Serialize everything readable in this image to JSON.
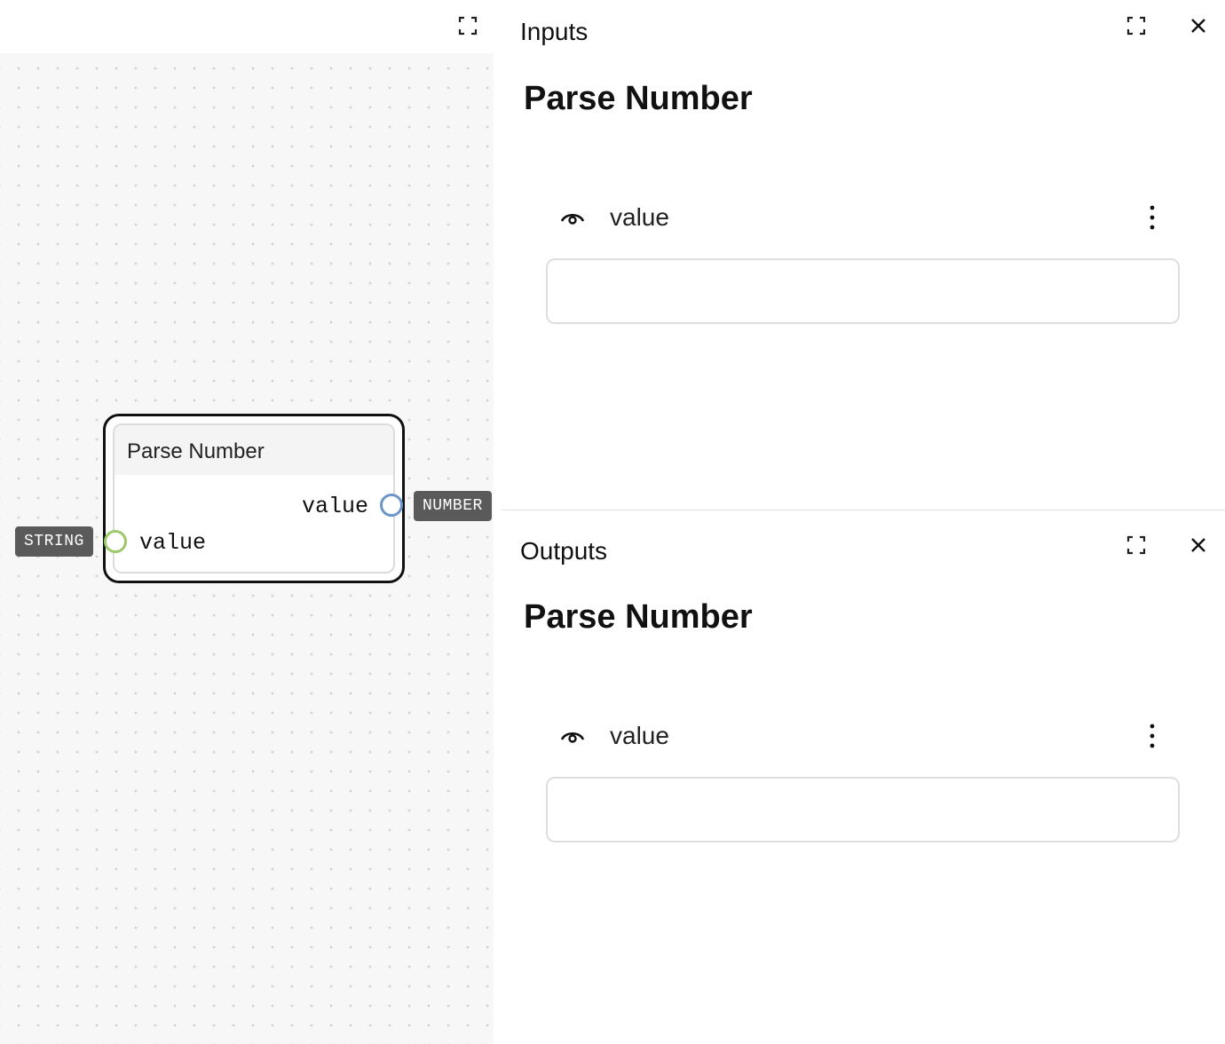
{
  "canvas": {
    "node": {
      "title": "Parse Number",
      "input_port": {
        "label": "value",
        "type": "STRING",
        "color": "#9cc96b"
      },
      "output_port": {
        "label": "value",
        "type": "NUMBER",
        "color": "#6b95c9"
      }
    },
    "icons": {
      "expand": "expand-icon"
    }
  },
  "inputs_panel": {
    "title": "Inputs",
    "node_title": "Parse Number",
    "fields": [
      {
        "label": "value",
        "value": "",
        "placeholder": ""
      }
    ],
    "icons": {
      "expand": "expand-icon",
      "close": "close-icon",
      "visibility": "eye-icon",
      "menu": "more-vertical-icon"
    }
  },
  "outputs_panel": {
    "title": "Outputs",
    "node_title": "Parse Number",
    "fields": [
      {
        "label": "value",
        "value": "",
        "placeholder": ""
      }
    ],
    "icons": {
      "expand": "expand-icon",
      "close": "close-icon",
      "visibility": "eye-icon",
      "menu": "more-vertical-icon"
    }
  },
  "colors": {
    "canvas_bg": "#f7f7f7",
    "badge_bg": "#5a5a5a",
    "node_border": "#111111"
  }
}
